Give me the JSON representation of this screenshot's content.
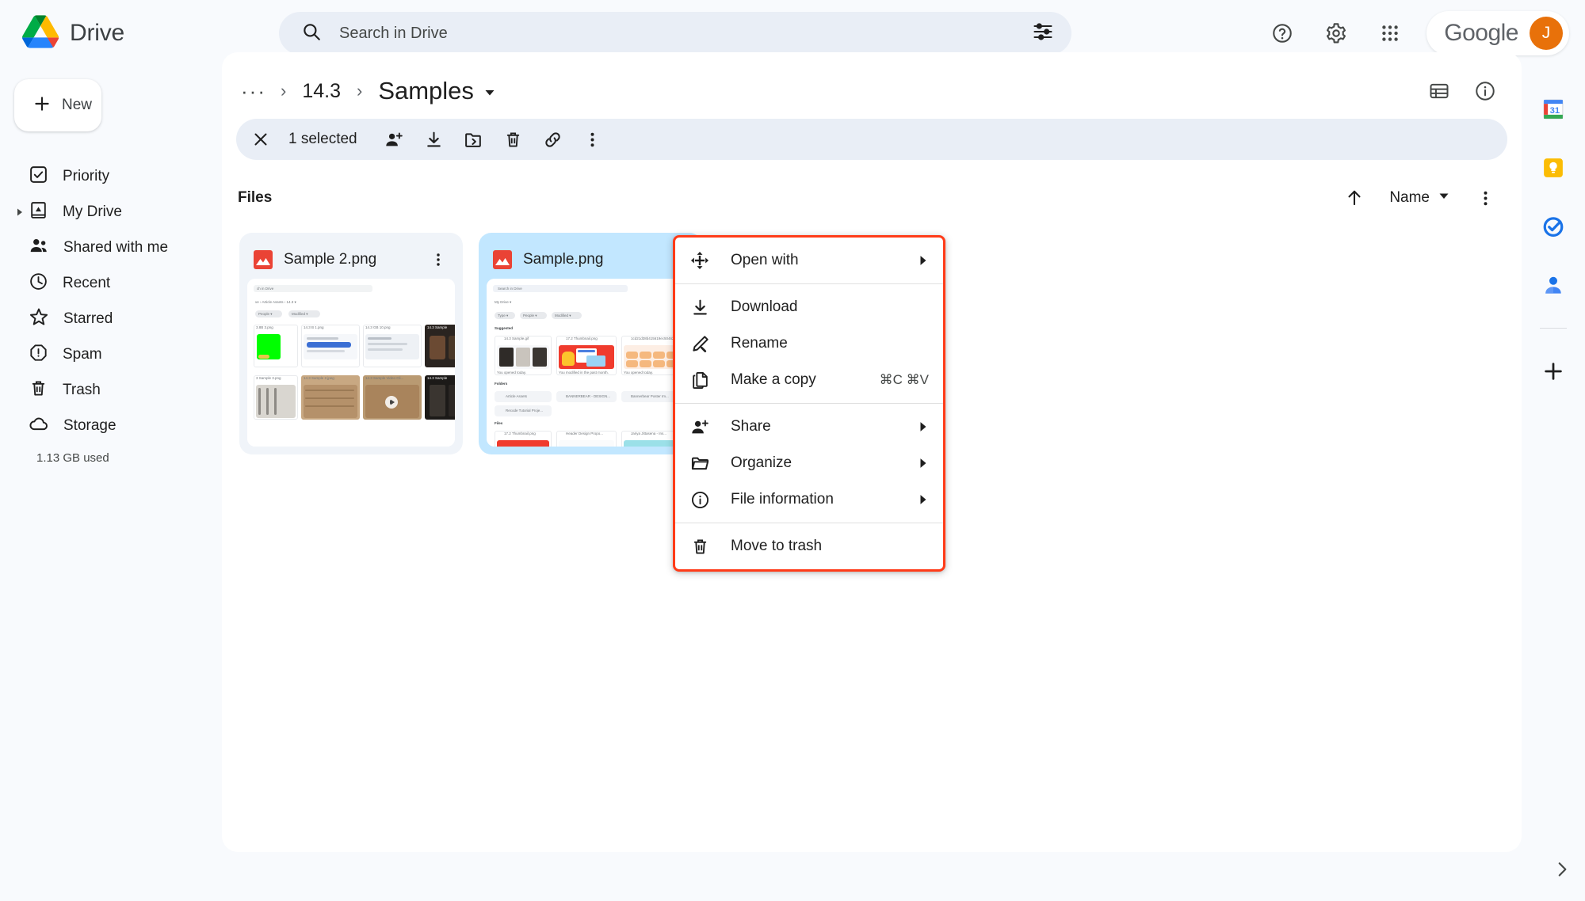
{
  "app": {
    "title": "Drive",
    "logo_colors": {
      "green": "#34a853",
      "yellow": "#fbbc04",
      "blue": "#1a73e8",
      "red": "#ea4335"
    }
  },
  "search": {
    "placeholder": "Search in Drive",
    "value": "",
    "icon": "search-icon",
    "filter_icon": "tune-icon"
  },
  "topbar": {
    "help_icon": "help-icon",
    "settings_icon": "gear-icon",
    "apps_icon": "apps-grid-icon",
    "account_word": "Google",
    "avatar_initial": "J",
    "avatar_color": "#e8710a"
  },
  "sidebar": {
    "new_button": {
      "label": "New",
      "icon": "plus-icon"
    },
    "items": [
      {
        "label": "Priority",
        "icon": "priority-check-icon",
        "expandable": false
      },
      {
        "label": "My Drive",
        "icon": "my-drive-icon",
        "expandable": true
      },
      {
        "label": "Shared with me",
        "icon": "people-icon",
        "expandable": false
      },
      {
        "label": "Recent",
        "icon": "clock-icon",
        "expandable": false
      },
      {
        "label": "Starred",
        "icon": "star-icon",
        "expandable": false
      },
      {
        "label": "Spam",
        "icon": "spam-icon",
        "expandable": false
      },
      {
        "label": "Trash",
        "icon": "trash-icon",
        "expandable": false
      },
      {
        "label": "Storage",
        "icon": "cloud-icon",
        "expandable": false
      }
    ],
    "storage_used": "1.13 GB used"
  },
  "breadcrumb": {
    "overflow": "···",
    "separator": "›",
    "parent": "14.3",
    "current": "Samples",
    "dropdown_icon": "chevron-down-icon",
    "list_view_icon": "list-view-icon",
    "info_icon": "info-icon"
  },
  "selection_bar": {
    "close_icon": "close-icon",
    "count_label": "1 selected",
    "actions": [
      {
        "name": "share-person-add-icon"
      },
      {
        "name": "download-icon"
      },
      {
        "name": "move-to-folder-icon"
      },
      {
        "name": "trash-icon"
      },
      {
        "name": "link-icon"
      },
      {
        "name": "more-vertical-icon"
      }
    ]
  },
  "files_section": {
    "title": "Files",
    "sort_direction_icon": "arrow-up-icon",
    "sort_label": "Name",
    "sort_dropdown_icon": "chevron-down-icon",
    "more_icon": "more-vertical-icon",
    "cards": [
      {
        "name": "Sample 2.png",
        "selected": false,
        "icon": "png-file-icon"
      },
      {
        "name": "Sample.png",
        "selected": true,
        "icon": "png-file-icon"
      }
    ]
  },
  "context_menu": {
    "highlight_color": "#ff3b18",
    "groups": [
      [
        {
          "label": "Open with",
          "icon": "open-with-move-icon",
          "submenu": true,
          "shortcut": ""
        }
      ],
      [
        {
          "label": "Download",
          "icon": "download-icon",
          "submenu": false,
          "shortcut": ""
        },
        {
          "label": "Rename",
          "icon": "pencil-icon",
          "submenu": false,
          "shortcut": ""
        },
        {
          "label": "Make a copy",
          "icon": "copy-icon",
          "submenu": false,
          "shortcut": "⌘C ⌘V"
        }
      ],
      [
        {
          "label": "Share",
          "icon": "share-person-add-icon",
          "submenu": true,
          "shortcut": ""
        },
        {
          "label": "Organize",
          "icon": "folder-icon",
          "submenu": true,
          "shortcut": ""
        },
        {
          "label": "File information",
          "icon": "info-icon",
          "submenu": true,
          "shortcut": ""
        }
      ],
      [
        {
          "label": "Move to trash",
          "icon": "trash-icon",
          "submenu": false,
          "shortcut": ""
        }
      ]
    ]
  },
  "right_rail": {
    "items": [
      {
        "name": "google-calendar-icon",
        "badge": "31"
      },
      {
        "name": "google-keep-icon",
        "badge": ""
      },
      {
        "name": "google-tasks-icon",
        "badge": ""
      },
      {
        "name": "google-contacts-icon",
        "badge": ""
      }
    ],
    "add_icon": "plus-icon",
    "expand_icon": "chevron-right-icon"
  },
  "thumbnails": {
    "card1": {
      "header": "ch in Drive",
      "crumb": "ve  ›  Article Assets  ›  14.3 ▾",
      "chips": [
        "People ▾",
        "Modified ▾"
      ],
      "rows": [
        [
          "3.8B 3.png",
          "14.3 B 1.png",
          "14.3 GB 10.png",
          "14.3 Sample"
        ],
        [
          "3 Sample 3.png",
          "14.3 Sample 2.jpeg",
          "14.3 Sample Video Cli...",
          "14.3 Sample"
        ]
      ]
    },
    "card2": {
      "header": "Search in Drive",
      "crumb": "My Drive ▾",
      "chips": [
        "Type ▾",
        "People ▾",
        "Modified ▾"
      ],
      "suggested_label": "Suggested",
      "folders_label": "Folders",
      "files_label": "Files",
      "suggested": [
        "14.3 Sample.gif",
        "17.2 Thumbnail.png",
        "1cd21d38b415619ec50462..."
      ],
      "folders": [
        "Article Assets",
        "BANNERBEAR - DESIGN...",
        "Bannerbear Poster Im..."
      ],
      "files": [
        "17.2 Thumbnail.png",
        "Header Design Propo...",
        "Jariya Jittasena - Ins..."
      ],
      "captions": [
        "You opened today.",
        "You modified in the past month.",
        "You opened today."
      ]
    }
  }
}
